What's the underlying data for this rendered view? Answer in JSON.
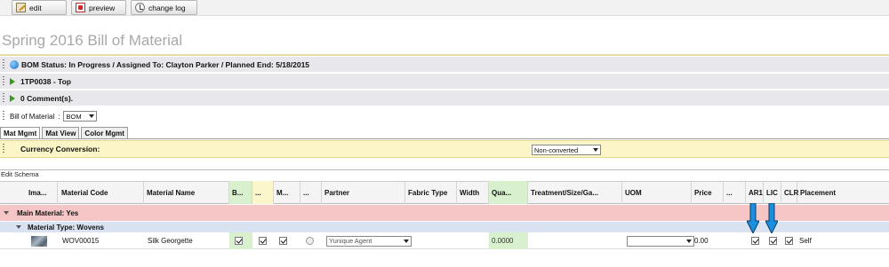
{
  "toolbar": {
    "edit": {
      "label": "edit",
      "icon": "edit-icon"
    },
    "preview": {
      "label": "preview",
      "icon": "pdf-icon"
    },
    "change_log": {
      "label": "change log",
      "icon": "change-log-icon"
    }
  },
  "page": {
    "title": "Spring 2016 Bill of Material"
  },
  "sections": {
    "status": "BOM  Status: In Progress / Assigned To: Clayton Parker / Planned End: 5/18/2015",
    "placement": "1TP0038 - Top",
    "comments": "0 Comment(s)."
  },
  "bom_selector": {
    "label": "Bill of Material",
    "colon": ":",
    "value": "BOM"
  },
  "tabs": [
    "Mat Mgmt",
    "Mat View",
    "Color Mgmt"
  ],
  "currency": {
    "label": "Currency Conversion:",
    "value": "Non-converted"
  },
  "schema": {
    "label": "Edit Schema"
  },
  "columns": {
    "image": "Ima...",
    "material_code": "Material Code",
    "material_name": "Material Name",
    "b": "B...",
    "dots1": "...",
    "m": "M...",
    "dots2": "...",
    "partner": "Partner",
    "fabric_type": "Fabric Type",
    "width": "Width",
    "quantity": "Qua...",
    "treatment": "Treatment/Size/Ga...",
    "uom": "UOM",
    "price": "Price",
    "dots3": "...",
    "ar": "AR1",
    "lic": "LIC",
    "clr": "CLR",
    "placement": "Placement"
  },
  "groups": {
    "main": "Main Material: Yes",
    "type": "Material Type: Wovens"
  },
  "row": {
    "material_code": "WOV00015",
    "material_name": "Silk Georgette",
    "partner": "Yunique Agent",
    "quantity": "0.0000",
    "uom": "",
    "price": "0.00",
    "placement": "Self",
    "checks": {
      "b": true,
      "dots1": true,
      "m": true,
      "ar": true,
      "lic": true,
      "clr": true
    }
  },
  "colors": {
    "arrow": "#1a8fe0",
    "group_main": "#f6c6c6",
    "group_type": "#d9e2f0",
    "currency_bg": "#fbf5c8"
  }
}
